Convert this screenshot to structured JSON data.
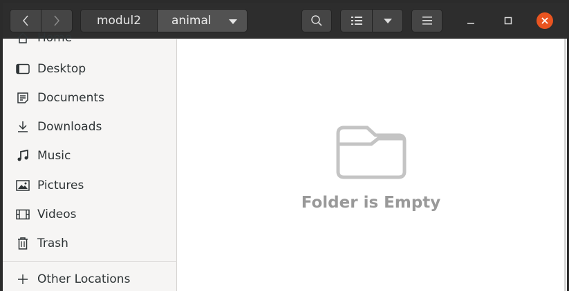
{
  "breadcrumb": {
    "parent": "modul2",
    "current": "animal"
  },
  "sidebar": {
    "items": [
      {
        "label": "Home",
        "icon": "home-icon"
      },
      {
        "label": "Desktop",
        "icon": "desktop-icon"
      },
      {
        "label": "Documents",
        "icon": "documents-icon"
      },
      {
        "label": "Downloads",
        "icon": "downloads-icon"
      },
      {
        "label": "Music",
        "icon": "music-icon"
      },
      {
        "label": "Pictures",
        "icon": "pictures-icon"
      },
      {
        "label": "Videos",
        "icon": "videos-icon"
      },
      {
        "label": "Trash",
        "icon": "trash-icon"
      },
      {
        "label": "Other Locations",
        "icon": "plus-icon"
      }
    ]
  },
  "main": {
    "empty_message": "Folder is Empty"
  },
  "colors": {
    "headerbar": "#2d2d2d",
    "close": "#e95420",
    "sidebar": "#f6f5f4"
  }
}
